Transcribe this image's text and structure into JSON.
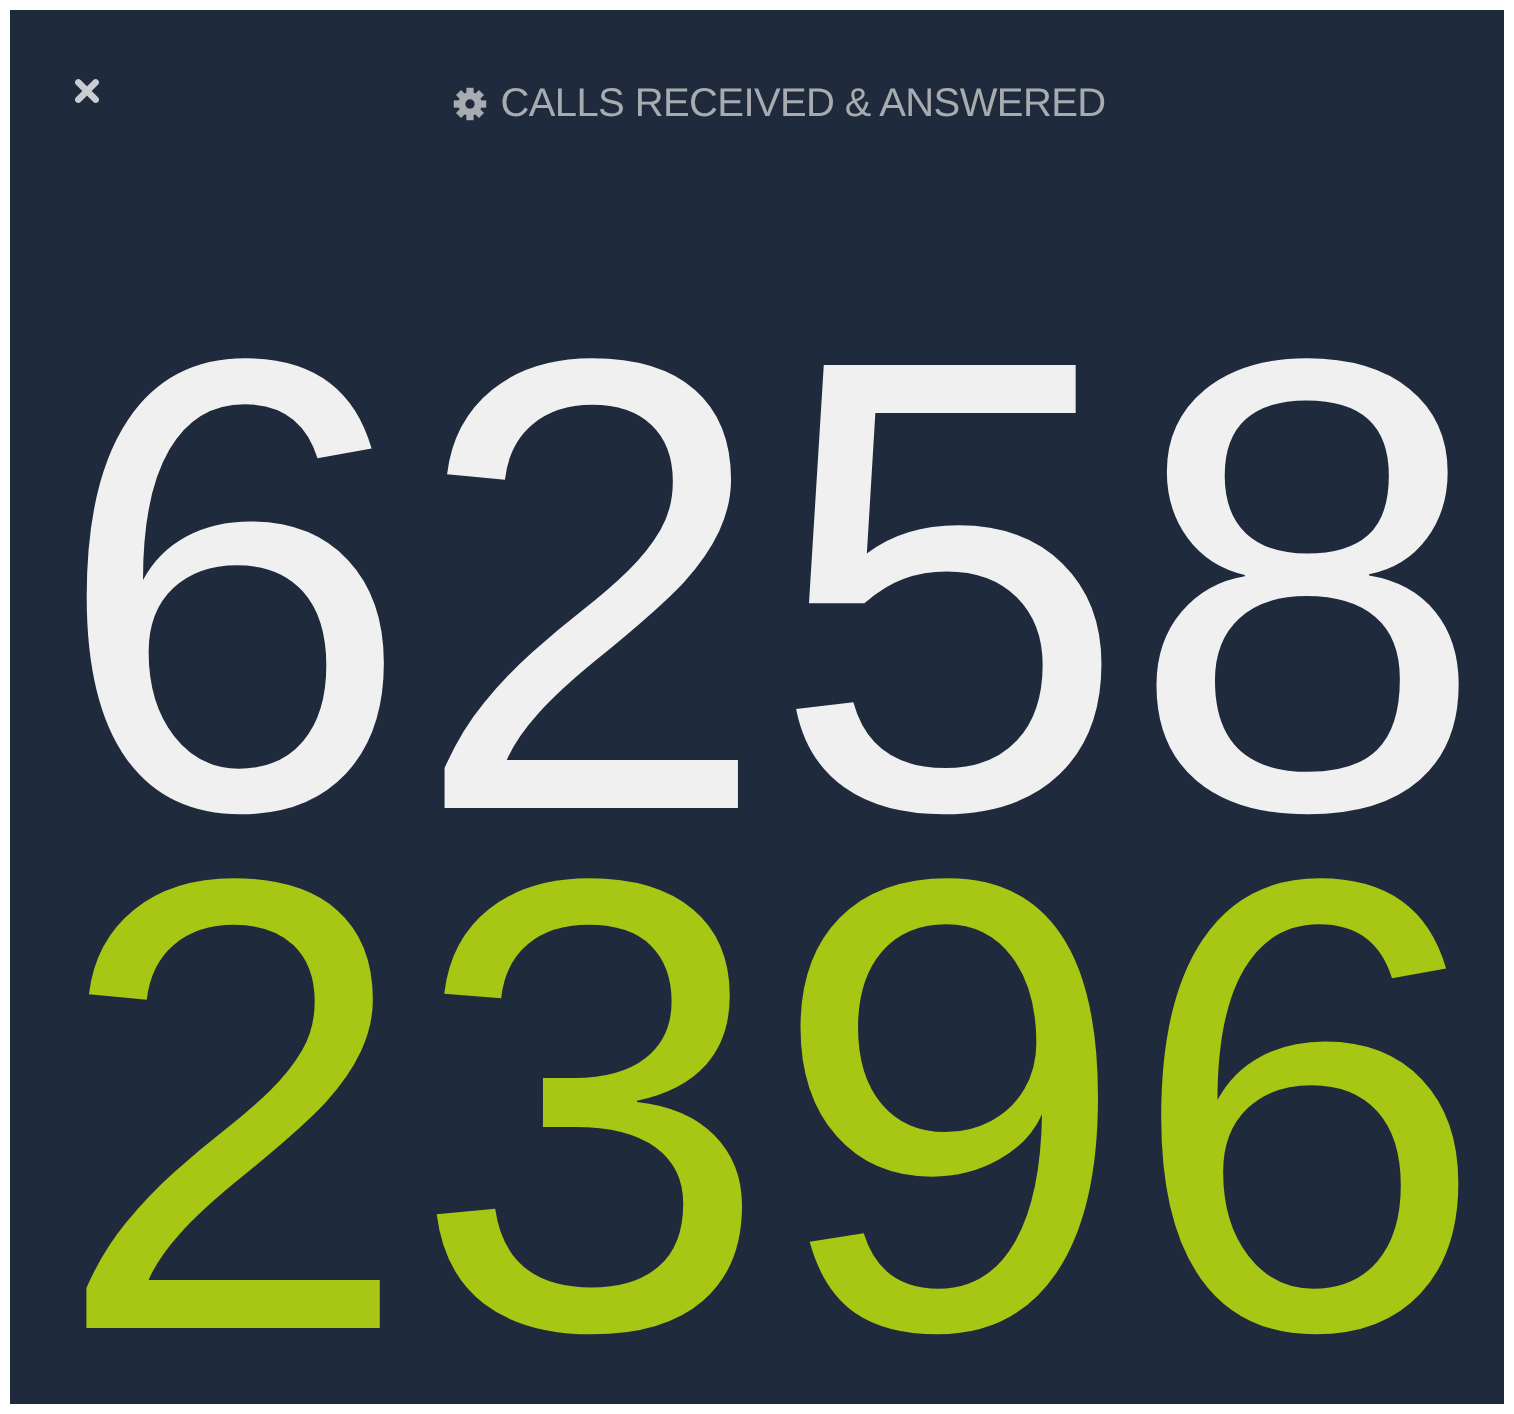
{
  "widget": {
    "title": "CALLS RECEIVED & ANSWERED"
  },
  "counts": [
    {
      "value": "6258",
      "color": "#f0f0f0"
    },
    {
      "value": "2396",
      "color": "#a8c614"
    }
  ]
}
